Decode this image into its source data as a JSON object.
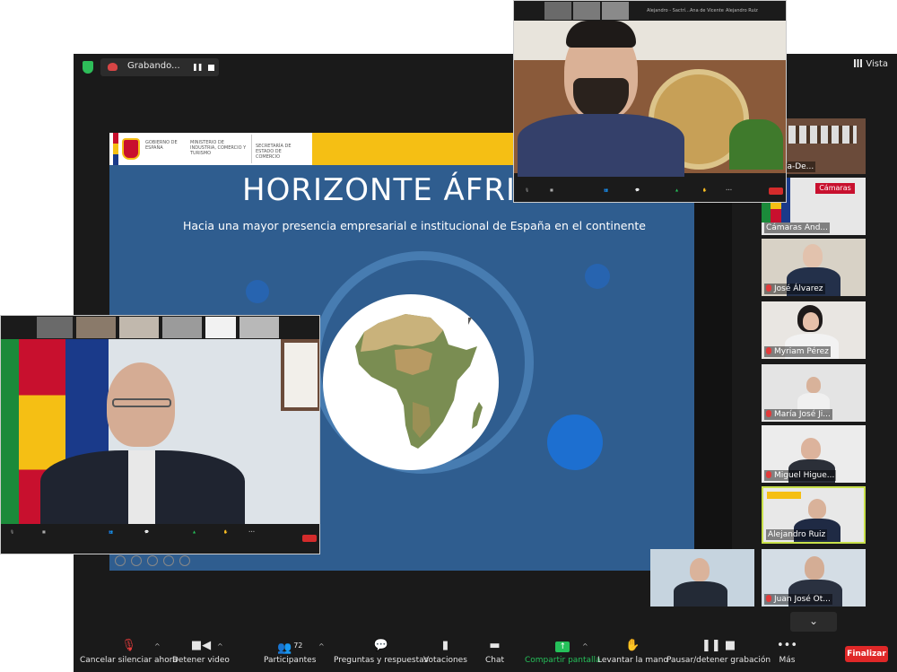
{
  "recording": {
    "label": "Grabando...",
    "pause_glyph": "❚❚"
  },
  "view": {
    "label": "Vista"
  },
  "slide": {
    "gov_line": "GOBIERNO DE ESPAÑA",
    "ministry": "MINISTERIO DE INDUSTRIA, COMERCIO Y TURISMO",
    "secretariat": "SECRETARÍA DE ESTADO DE COMERCIO",
    "title": "HORIZONTE ÁFRI",
    "subtitle": "Hacia una mayor presencia empresarial e institucional de España en el continente"
  },
  "gallery": [
    {
      "name": "García-De..."
    },
    {
      "name": "Cámaras And..."
    },
    {
      "name": "José Álvarez"
    },
    {
      "name": "Myriam Pérez"
    },
    {
      "name": "María José Ji..."
    },
    {
      "name": "Miguel Higue..."
    },
    {
      "name": "Alejandro Ruiz"
    },
    {
      "name": "Juan José Ot..."
    }
  ],
  "toolbar": {
    "mute": "Cancelar silenciar ahora",
    "video": "Detener video",
    "participants": "Participantes",
    "participants_count": "72",
    "qa": "Preguntas y respuestas",
    "polls": "Votaciones",
    "chat": "Chat",
    "share": "Compartir pantalla",
    "raise_hand": "Levantar la mano",
    "pause_rec": "Pausar/detener grabación",
    "more": "Más",
    "end": "Finalizar"
  },
  "overlay_top": {
    "names": [
      "Alejandro - Sactrí...",
      "Ana de Vicente",
      "Alejandro Ruiz"
    ]
  },
  "colors": {
    "zoom_bg": "#1a1a1a",
    "slide_blue": "#2f5d8f",
    "share_green": "#25c05a",
    "end_red": "#e02828",
    "active_speaker": "#c8e04a"
  }
}
